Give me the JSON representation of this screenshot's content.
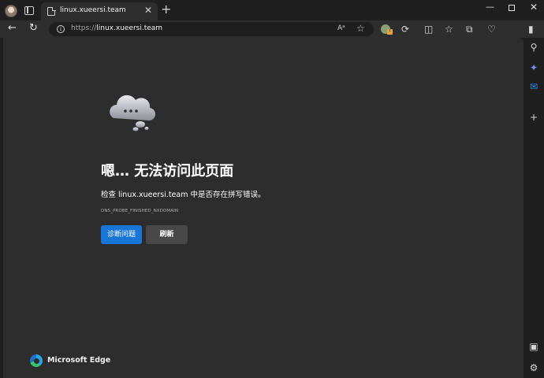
{
  "browser": {
    "tab_title": "linux.xueersi.team",
    "tab_close_glyph": "✕",
    "new_tab_glyph": "+",
    "window_controls": {
      "minimize": "—",
      "maximize": "",
      "close": "✕"
    }
  },
  "address_bar": {
    "url_scheme": "https://",
    "url_host": "linux.xueersi.team",
    "read_aloud_glyph": "Aᵃ",
    "favorite_glyph": "☆"
  },
  "toolbar_icons": [
    "profile-icon",
    "tab-actions-icon",
    "back-icon",
    "refresh-icon",
    "info-icon",
    "read-aloud-icon",
    "favorite-star-icon",
    "extension-icon",
    "performance-icon",
    "split-screen-icon",
    "favorites-icon",
    "collections-icon",
    "copilot-health-icon",
    "sidebar-toggle-icon"
  ],
  "error_page": {
    "headline": "嗯… 无法访问此页面",
    "check_text": "检查 linux.xueersi.team 中是否存在拼写错误。",
    "error_code": "DNS_PROBE_FINISHED_NXDOMAIN",
    "diagnose_button": "诊断问题",
    "refresh_button": "刷新",
    "brand": "Microsoft Edge"
  },
  "sidebar": {
    "icons": [
      "search-icon",
      "copilot-icon",
      "outlook-icon",
      "add-icon",
      "screenshot-icon",
      "settings-icon"
    ]
  },
  "colors": {
    "primary_button": "#1877d6",
    "page_background": "#2d2d2d",
    "chrome_background": "#1f1f1f"
  }
}
